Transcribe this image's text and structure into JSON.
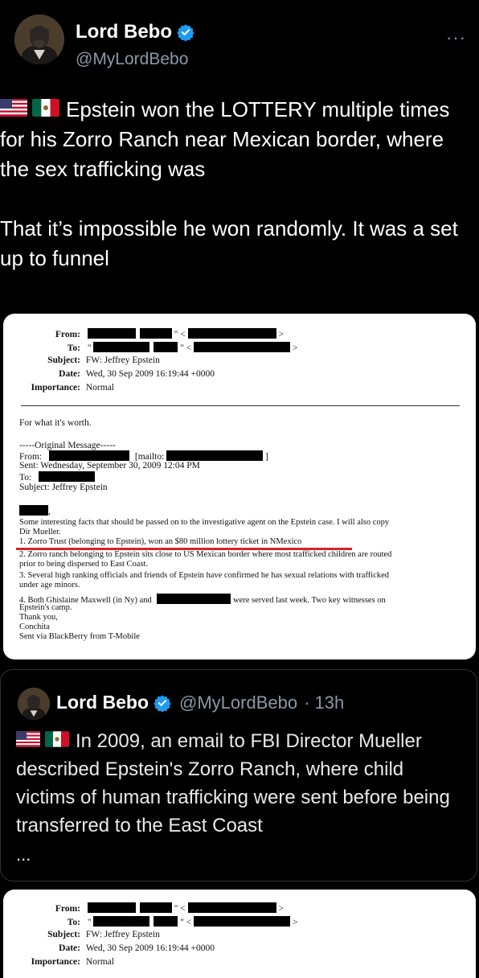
{
  "author": {
    "name": "Lord Bebo",
    "handle": "@MyLordBebo",
    "more_label": "···"
  },
  "tweet": {
    "line1": "Epstein won the LOTTERY multiple times for his Zorro Ranch near Mexican border, where the sex trafficking was",
    "line2": "That it’s impossible he won randomly. It was a set up to funnel"
  },
  "document": {
    "from_label": "From:",
    "to_label": "To:",
    "to_value": "\"",
    "quote_mark": "\"",
    "subject_label": "Subject:",
    "subject_value": "FW: Jeffrey Epstein",
    "date_label": "Date:",
    "date_value": "Wed, 30 Sep 2009 16:19:44 +0000",
    "importance_label": "Importance:",
    "importance_value": "Normal",
    "lt": "<",
    "gt": ">",
    "intro": "For what it's worth.",
    "original": "-----Original Message-----",
    "orig_from": "From:",
    "mailto": "[mailto:",
    "bracket_close": "]",
    "sent": "Sent: Wednesday, September 30, 2009 12:04 PM",
    "to": "To:",
    "subject": "Subject: Jeffrey Epstein",
    "body_comma": ",",
    "body1": "Some interesting facts that should be passed on to the investigative agent on the Epstein case. I will also copy",
    "body2": "Dir Mueller.",
    "item1": "1. Zorro Trust (belonging to Epstein), won an $80 million lottery ticket in NMexico",
    "item2a": "2. Zorro ranch belonging to Epstein sits close to US Mexican border where most trafficked children are routed",
    "item2b": "prior to being dispersed to East Coast.",
    "item3a": "3. Several high ranking officials and friends of Epstein have confirmed he has sexual relations with trafficked",
    "item3b": "under age minors.",
    "item4a": "4. Both Ghislaine Maxwell (in Ny) and",
    "item4a_end": "were served last week. Two key witnesses on",
    "item4b": "Epstein's camp.",
    "thanks": "Thank you,",
    "sig": "Conchita",
    "via": "Sent via BlackBerry from T-Mobile"
  },
  "quoted": {
    "name": "Lord Bebo",
    "handle": "@MyLordBebo",
    "time": "· 13h",
    "text": "In 2009, an email to FBI Director Mueller described Epstein's Zorro Ranch, where child victims of human trafficking were sent before being transferred to the East Coast",
    "ellipsis": "..."
  },
  "colors": {
    "background": "#000000",
    "verified": "#1d9bf0",
    "muted": "#8b98a5",
    "underline": "#dd2222"
  },
  "icons": [
    "verified-badge-icon",
    "more-options-icon",
    "us-flag-icon",
    "mexico-flag-icon"
  ]
}
